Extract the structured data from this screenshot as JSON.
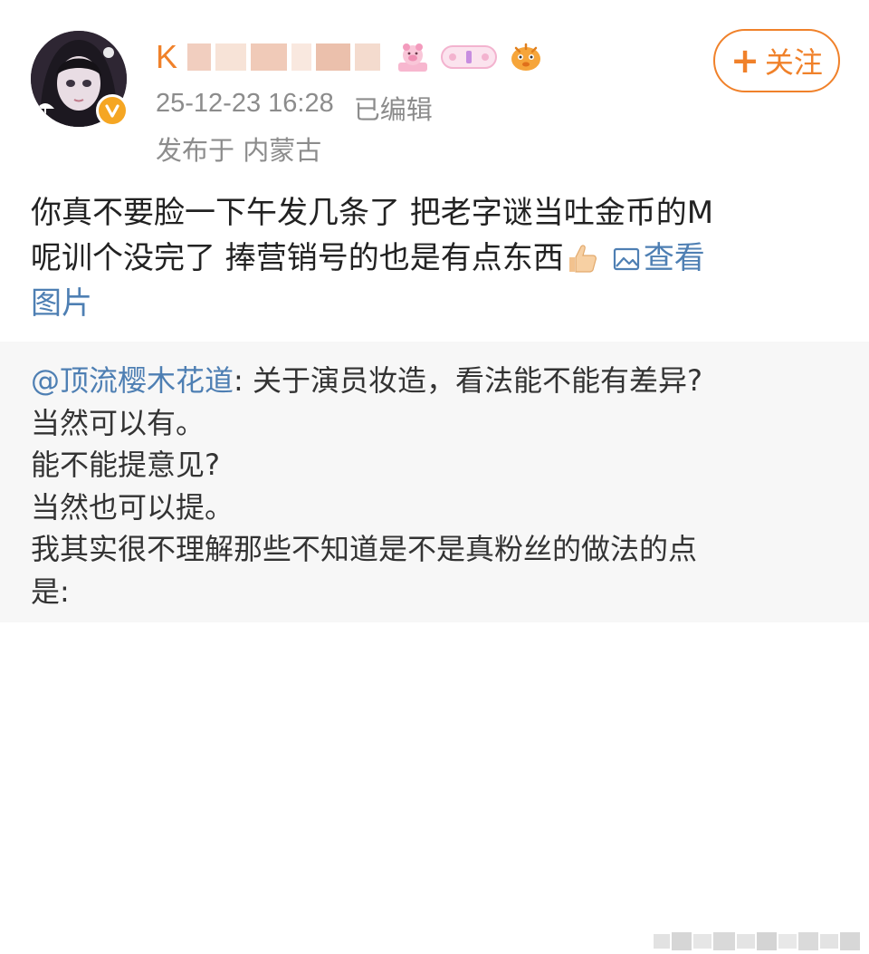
{
  "author": {
    "name_visible_prefix": "K",
    "verified_badge": "verified-v-icon",
    "badges": [
      "pig-badge-icon",
      "pill-badge-icon",
      "pufferfish-badge-icon"
    ]
  },
  "post_meta": {
    "timestamp": "25-12-23 16:28",
    "edited": "已编辑",
    "location": "发布于 内蒙古"
  },
  "follow_button": {
    "plus": "+",
    "label": "关注"
  },
  "post": {
    "line1": "你真不要脸一下午发几条了 把老字谜当吐金币的M",
    "line2": "呢训个没完了 捧营销号的也是有点东西",
    "view_image_label": "查看",
    "view_image_label_wrap": "图片"
  },
  "repost": {
    "mention": "@顶流樱木花道",
    "first_line_rest": ": 关于演员妆造，看法能不能有差异?",
    "lines": [
      "当然可以有。",
      "能不能提意见?",
      "当然也可以提。",
      "我其实很不理解那些不知道是不是真粉丝的做法的点",
      "是:"
    ]
  },
  "colors": {
    "accent_orange": "#f0812a",
    "link_blue": "#4e7fb3",
    "meta_gray": "#8c8c8c",
    "repost_bg": "#f7f7f7"
  }
}
